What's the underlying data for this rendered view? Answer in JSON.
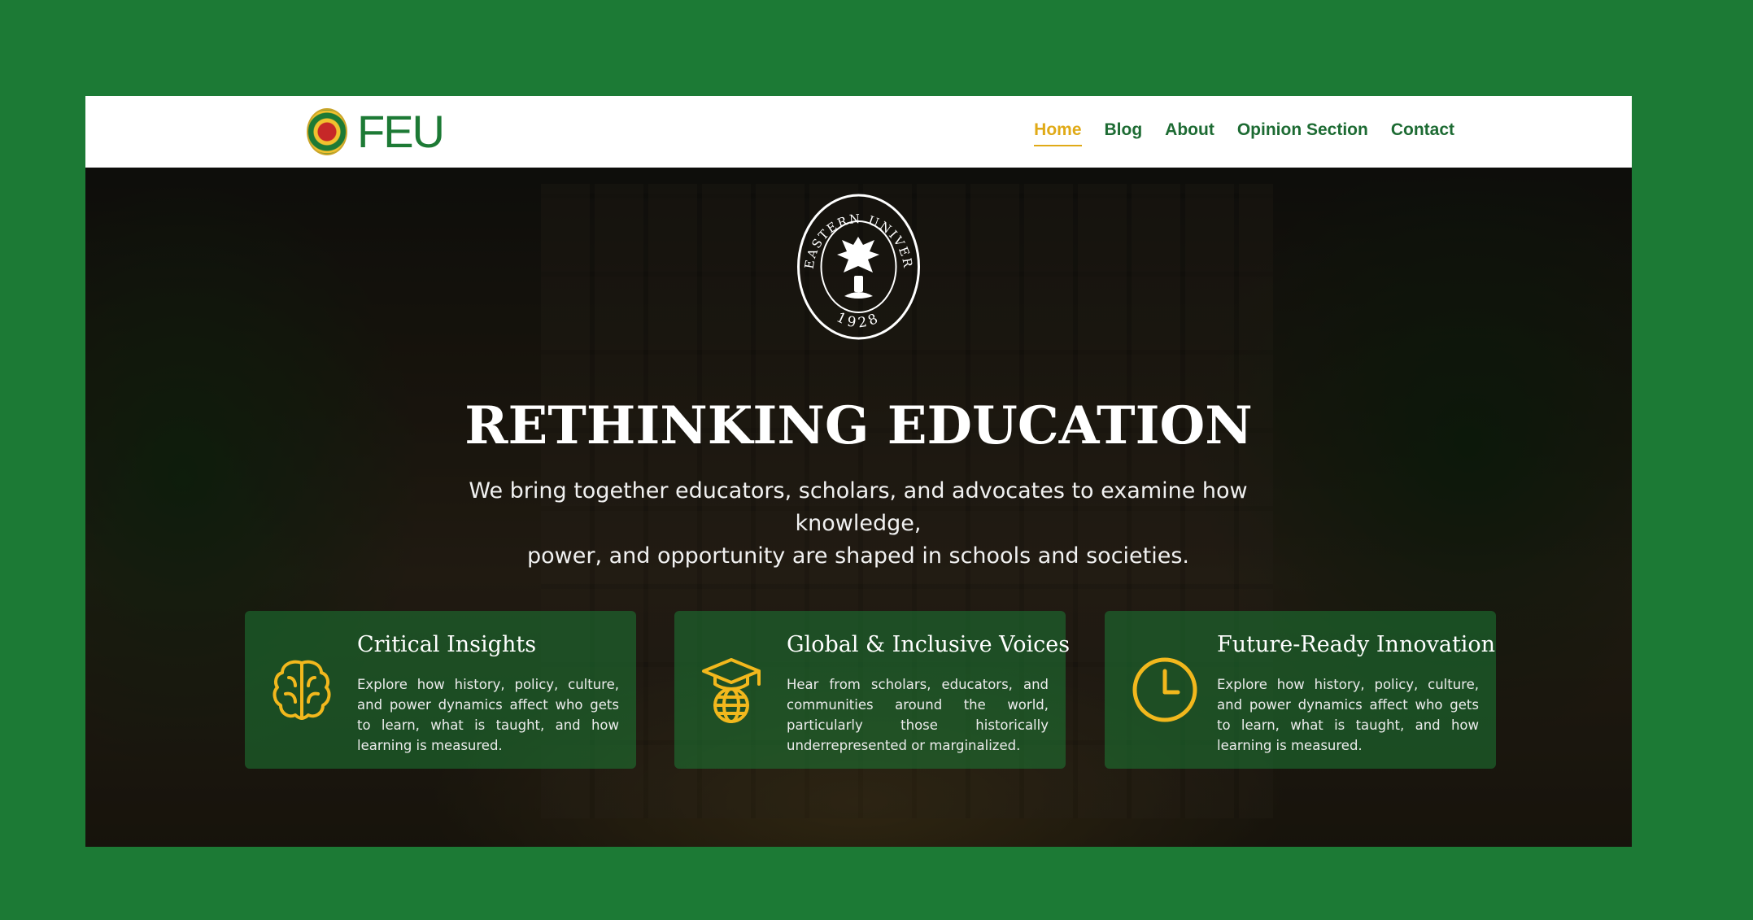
{
  "brand": {
    "name": "FEU"
  },
  "nav": {
    "items": [
      {
        "label": "Home",
        "active": true
      },
      {
        "label": "Blog",
        "active": false
      },
      {
        "label": "About",
        "active": false
      },
      {
        "label": "Opinion Section",
        "active": false
      },
      {
        "label": "Contact",
        "active": false
      }
    ]
  },
  "seal": {
    "top_text": "FAR EASTERN UNIVERSITY",
    "year": "1928"
  },
  "hero": {
    "title": "RETHINKING EDUCATION",
    "subtitle_line1": "We bring together educators, scholars, and advocates to examine how knowledge,",
    "subtitle_line2": "power, and opportunity are shaped in schools and societies."
  },
  "cards": [
    {
      "icon": "brain-icon",
      "title": "Critical Insights",
      "text": "Explore how history, policy, culture, and power dynamics affect who gets to learn, what is taught, and how learning is measured."
    },
    {
      "icon": "graduation-globe-icon",
      "title": "Global & Inclusive Voices",
      "text": "Hear from scholars, educators, and communities around the world, particularly those historically underrepresented or marginalized."
    },
    {
      "icon": "clock-icon",
      "title": "Future-Ready Innovation",
      "text": "Explore how history, policy, culture, and power dynamics affect who gets to learn, what is taught, and how learning is measured."
    }
  ],
  "colors": {
    "page_bg": "#1c7a35",
    "brand_green": "#1d7a35",
    "accent_gold": "#e0aa17"
  }
}
